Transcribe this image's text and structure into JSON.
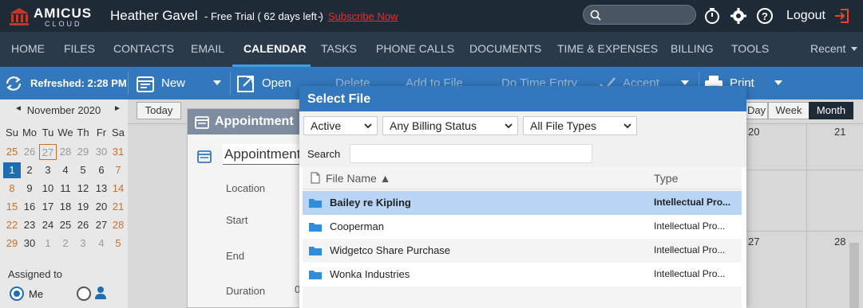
{
  "brand": {
    "name": "AMICUS",
    "sub": "CLOUD"
  },
  "header": {
    "user_name": "Heather Gavel",
    "trial": "- Free Trial ( 62 days left )",
    "separator": "-",
    "subscribe": "Subscribe Now",
    "logout": "Logout"
  },
  "nav": {
    "items": [
      "HOME",
      "FILES",
      "CONTACTS",
      "EMAIL",
      "CALENDAR",
      "TASKS",
      "PHONE CALLS",
      "DOCUMENTS",
      "TIME & EXPENSES",
      "BILLING",
      "TOOLS"
    ],
    "active": "CALENDAR",
    "recent": "Recent"
  },
  "toolbar": {
    "refreshed": "Refreshed: 2:28 PM",
    "new": "New",
    "open": "Open",
    "delete": "Delete",
    "add_to_file": "Add to File",
    "do_time_entry": "Do Time Entry",
    "accept": "Accept",
    "print": "Print"
  },
  "mini_calendar": {
    "month": "November 2020",
    "weekdays": [
      "Su",
      "Mo",
      "Tu",
      "We",
      "Th",
      "Fr",
      "Sa"
    ],
    "weeks": [
      [
        "25",
        "26",
        "27",
        "28",
        "29",
        "30",
        "31"
      ],
      [
        "1",
        "2",
        "3",
        "4",
        "5",
        "6",
        "7"
      ],
      [
        "8",
        "9",
        "10",
        "11",
        "12",
        "13",
        "14"
      ],
      [
        "15",
        "16",
        "17",
        "18",
        "19",
        "20",
        "21"
      ],
      [
        "22",
        "23",
        "24",
        "25",
        "26",
        "27",
        "28"
      ],
      [
        "29",
        "30",
        "1",
        "2",
        "3",
        "4",
        "5"
      ]
    ],
    "prev": "◄",
    "next": "►"
  },
  "assigned": {
    "label": "Assigned to",
    "me": "Me"
  },
  "calendar_view": {
    "today": "Today",
    "day": "Day",
    "week": "Week",
    "month": "Month",
    "nums": [
      "20",
      "21",
      "27",
      "28"
    ]
  },
  "appointment": {
    "title": "Appointment",
    "name_value": "Appointment",
    "fields": [
      "Location",
      "Start",
      "End",
      "Duration"
    ],
    "duration_value": "0"
  },
  "select_file": {
    "title": "Select File",
    "status": "Active",
    "billing": "Any Billing Status",
    "file_types": "All File Types",
    "search_label": "Search",
    "search_value": "",
    "col_file": "File Name ▲",
    "col_type": "Type",
    "rows": [
      {
        "name": "Bailey re Kipling",
        "type": "Intellectual Pro..."
      },
      {
        "name": "Cooperman",
        "type": "Intellectual Pro..."
      },
      {
        "name": "Widgetco Share Purchase",
        "type": "Intellectual Pro..."
      },
      {
        "name": "Wonka Industries",
        "type": "Intellectual Pro..."
      }
    ]
  },
  "colors": {
    "topbar": "#1f2a37",
    "nav": "#2b3a4a",
    "toolbar": "#3378bd",
    "accent": "#3aa0e6",
    "selected_row": "#b8d5f5",
    "subscribe": "#e03030"
  }
}
